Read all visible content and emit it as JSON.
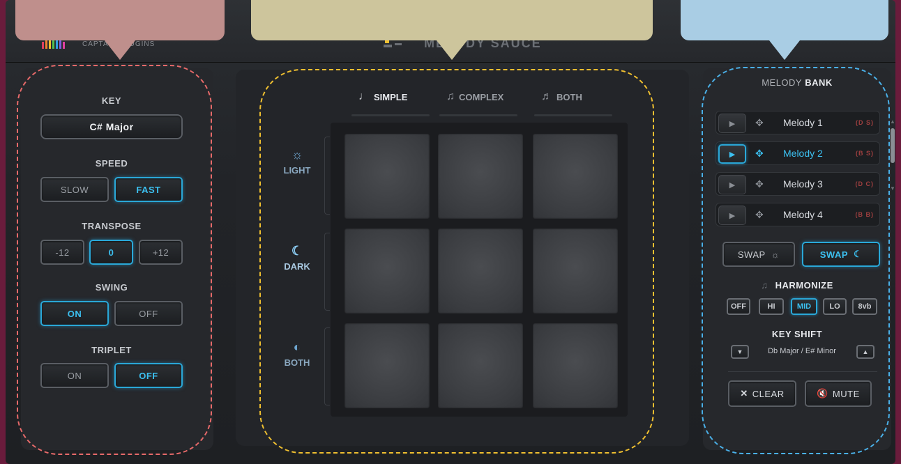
{
  "brand": {
    "plugin_name": "MELODY SAUCE",
    "logo_sub": "CAPTAIN PLUGINS"
  },
  "left": {
    "key": {
      "label": "KEY",
      "value": "C# Major"
    },
    "speed": {
      "label": "SPEED",
      "options": [
        "SLOW",
        "FAST"
      ],
      "selected": "FAST"
    },
    "transpose": {
      "label": "TRANSPOSE",
      "options": [
        "-12",
        "0",
        "+12"
      ],
      "selected": "0"
    },
    "swing": {
      "label": "SWING",
      "options": [
        "ON",
        "OFF"
      ],
      "selected": "ON"
    },
    "triplet": {
      "label": "TRIPLET",
      "options": [
        "ON",
        "OFF"
      ],
      "selected": "OFF"
    }
  },
  "center": {
    "tabs": [
      {
        "label": "SIMPLE",
        "icon": "single-note-icon"
      },
      {
        "label": "COMPLEX",
        "icon": "double-note-icon"
      },
      {
        "label": "BOTH",
        "icon": "multi-note-icon"
      }
    ],
    "rows": [
      {
        "label": "LIGHT",
        "icon": "sun-icon",
        "active": false
      },
      {
        "label": "DARK",
        "icon": "moon-icon",
        "active": true
      },
      {
        "label": "BOTH",
        "icon": "sun-moon-icon",
        "active": false
      }
    ]
  },
  "right": {
    "title_prefix": "MELODY",
    "title_suffix": "BANK",
    "melodies": [
      {
        "name": "Melody 1",
        "tag": "(D S)",
        "active": false
      },
      {
        "name": "Melody 2",
        "tag": "(B S)",
        "active": true
      },
      {
        "name": "Melody 3",
        "tag": "(D C)",
        "active": false
      },
      {
        "name": "Melody 4",
        "tag": "(B B)",
        "active": false
      }
    ],
    "swap_light": "SWAP",
    "swap_dark": "SWAP",
    "harmonize": {
      "label": "HARMONIZE",
      "options": [
        "OFF",
        "HI",
        "MID",
        "LO",
        "8vb"
      ],
      "selected": "MID"
    },
    "key_shift": {
      "label": "KEY SHIFT",
      "value": "Db Major / E# Minor"
    },
    "clear": "CLEAR",
    "mute": "MUTE"
  },
  "colors": {
    "accent": "#2aa8d8",
    "background": "#6a1c3c",
    "callout_left": "#bf8f8c",
    "callout_mid": "#cdc59c",
    "callout_right": "#a9cde4"
  }
}
